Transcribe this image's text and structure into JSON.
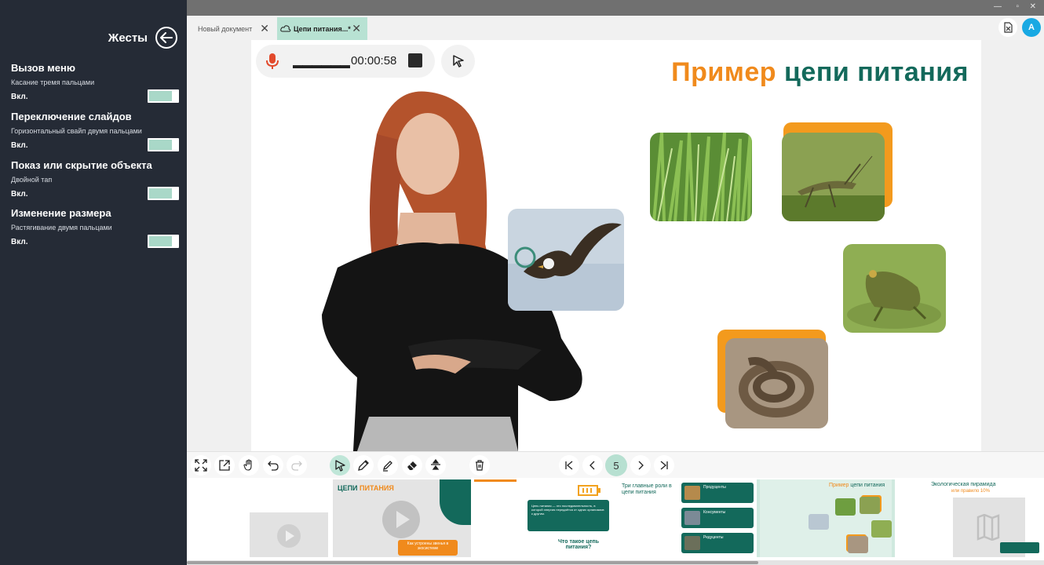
{
  "panel": {
    "title": "Жесты",
    "settings": [
      {
        "title": "Вызов меню",
        "desc": "Касание тремя пальцами",
        "state": "Вкл."
      },
      {
        "title": "Переключение слайдов",
        "desc": "Горизонтальный свайп двумя пальцами",
        "state": "Вкл."
      },
      {
        "title": "Показ или скрытие объекта",
        "desc": "Двойной тап",
        "state": "Вкл."
      },
      {
        "title": "Изменение размера",
        "desc": "Растягивание двумя пальцами",
        "state": "Вкл."
      }
    ]
  },
  "tabs": [
    {
      "label": "Новый документ",
      "active": false
    },
    {
      "label": "Цепи питания...*",
      "active": true
    }
  ],
  "user": {
    "avatar_letter": "A"
  },
  "recorder": {
    "level": "▬▬▬▬▬▬",
    "time": "00:00:58"
  },
  "slide": {
    "title_part1": "Пример",
    "title_part2": "цепи питания"
  },
  "pager": {
    "current": "5"
  },
  "thumbnails": {
    "t2_title_a": "ЦЕПИ",
    "t2_title_b": "ПИТАНИЯ",
    "t2_button": "Как устроены звенья в экосистеме",
    "t3_text": "Цепь питания — это последовательность, в которой энергия передаётся от одних организмов к другим.",
    "t3_question": "Что такое цепь питания?",
    "t4_title": "Три главные роли в цепи питания",
    "t4_items": [
      "Продуценты",
      "Консументы",
      "Редуценты"
    ],
    "t5_title_a": "Пример",
    "t5_title_b": "цепи питания",
    "t6_title": "Экологическая пирамида",
    "t6_subtitle": "или правило 10%"
  },
  "colors": {
    "accent_green": "#13695b",
    "accent_orange": "#f08a1c",
    "mint": "#b8e2d3",
    "panel_bg": "#252b36"
  }
}
